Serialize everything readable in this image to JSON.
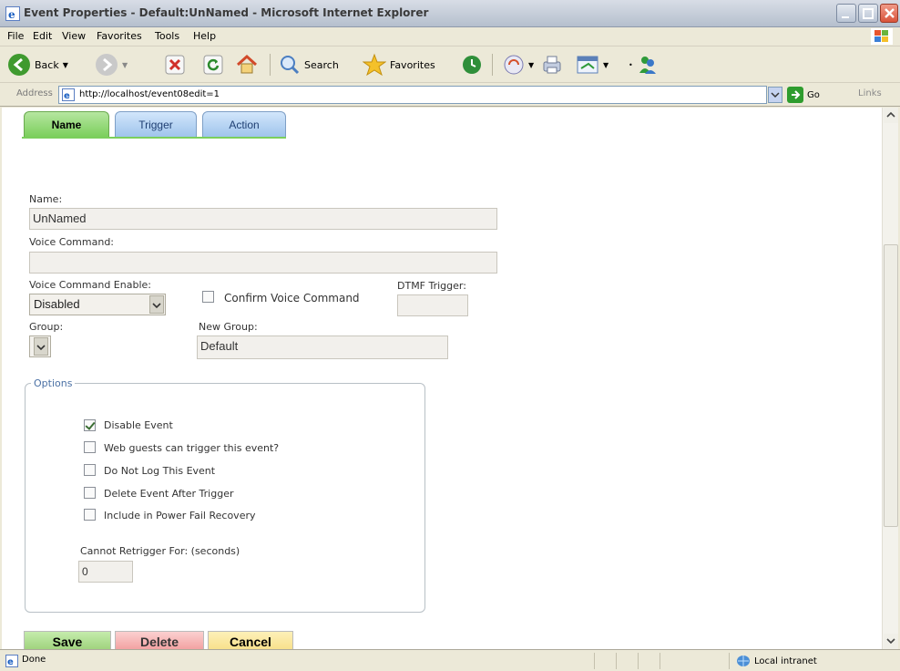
{
  "window": {
    "title": "Event Properties - Default:UnNamed - Microsoft Internet Explorer"
  },
  "menu": [
    "File",
    "Edit",
    "View",
    "Favorites",
    "Tools",
    "Help"
  ],
  "toolbar": {
    "back_label": "Back",
    "search_label": "Search",
    "favorites_label": "Favorites"
  },
  "address": {
    "label": "Address",
    "url": "http://localhost/event08edit=1",
    "go_label": "Go",
    "links_label": "Links"
  },
  "tabs": [
    {
      "label": "Name",
      "active": true
    },
    {
      "label": "Trigger",
      "active": false
    },
    {
      "label": "Action",
      "active": false
    }
  ],
  "form": {
    "name_label": "Name:",
    "name_value": "UnNamed",
    "voice_command_label": "Voice Command:",
    "voice_command_value": "",
    "voice_enable_label": "Voice Command Enable:",
    "voice_enable_value": "Disabled",
    "confirm_voice_label": "Confirm Voice Command",
    "dtmf_label": "DTMF Trigger:",
    "dtmf_value": "",
    "group_label": "Group:",
    "group_value": "",
    "new_group_label": "New Group:",
    "new_group_value": "Default"
  },
  "options": {
    "legend": "Options",
    "items": [
      {
        "label": "Disable Event",
        "checked": true
      },
      {
        "label": "Web guests can trigger this event?",
        "checked": false
      },
      {
        "label": "Do Not Log This Event",
        "checked": false
      },
      {
        "label": "Delete Event After Trigger",
        "checked": false
      },
      {
        "label": "Include in Power Fail Recovery",
        "checked": false
      }
    ],
    "retrigger_label": "Cannot Retrigger For: (seconds)",
    "retrigger_value": "0"
  },
  "actions": {
    "save_label": "Save",
    "delete_label": "Delete",
    "cancel_label": "Cancel"
  },
  "status": {
    "text": "Done",
    "zone": "Local intranet"
  },
  "colors": {
    "tab_active": "#7bcf5c",
    "tab_inactive": "#9fc4ec",
    "save": "#9ed27c",
    "delete": "#f2a0a0",
    "cancel": "#f8e08a"
  }
}
